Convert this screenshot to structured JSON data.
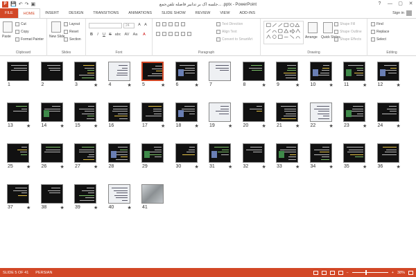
{
  "window": {
    "title": "جلسه اک بر تدابیر فاصله تلفن‌جمع... .pptx - PowerPoint",
    "controls": [
      "?",
      "—",
      "▢",
      "✕"
    ]
  },
  "quick_access": {
    "logo": "P",
    "save": "💾",
    "undo": "↶",
    "redo": "↷",
    "start": "▣"
  },
  "tabs": [
    {
      "label": "FILE",
      "state": "file"
    },
    {
      "label": "HOME",
      "state": "active"
    },
    {
      "label": "INSERT",
      "state": ""
    },
    {
      "label": "DESIGN",
      "state": ""
    },
    {
      "label": "TRANSITIONS",
      "state": ""
    },
    {
      "label": "ANIMATIONS",
      "state": ""
    },
    {
      "label": "SLIDE SHOW",
      "state": ""
    },
    {
      "label": "REVIEW",
      "state": ""
    },
    {
      "label": "VIEW",
      "state": ""
    },
    {
      "label": "ADD-INS",
      "state": ""
    }
  ],
  "signin": "Sign in",
  "ribbon": {
    "clipboard": {
      "label": "Clipboard",
      "paste": "Paste",
      "cut": "Cut",
      "copy": "Copy",
      "format_painter": "Format Painter"
    },
    "slides": {
      "label": "Slides",
      "new_slide": "New Slide",
      "layout": "Layout",
      "reset": "Reset",
      "section": "Section"
    },
    "font": {
      "label": "Font",
      "size": "24",
      "bold": "B",
      "italic": "I",
      "underline": "U",
      "strike": "S",
      "shadow": "abc",
      "spacing": "AV",
      "case": "Aa",
      "color": "A"
    },
    "paragraph": {
      "label": "Paragraph",
      "text_direction": "Text Direction",
      "align_text": "Align Text",
      "convert_smartart": "Convert to SmartArt"
    },
    "drawing": {
      "label": "Drawing",
      "arrange": "Arrange",
      "quick_styles": "Quick Styles",
      "shape_fill": "Shape Fill",
      "shape_outline": "Shape Outline",
      "shape_effects": "Shape Effects"
    },
    "editing": {
      "label": "Editing",
      "find": "Find",
      "replace": "Replace",
      "select": "Select"
    }
  },
  "slides": [
    {
      "n": "1",
      "star": false,
      "kind": "dark"
    },
    {
      "n": "2",
      "star": false,
      "kind": "dark"
    },
    {
      "n": "3",
      "star": true,
      "kind": "dark"
    },
    {
      "n": "4",
      "star": true,
      "kind": "light"
    },
    {
      "n": "5",
      "star": true,
      "kind": "dark"
    },
    {
      "n": "6",
      "star": true,
      "kind": "dark"
    },
    {
      "n": "7",
      "star": false,
      "kind": "light"
    },
    {
      "n": "8",
      "star": true,
      "kind": "dark"
    },
    {
      "n": "9",
      "star": true,
      "kind": "dark"
    },
    {
      "n": "10",
      "star": true,
      "kind": "dark"
    },
    {
      "n": "11",
      "star": true,
      "kind": "dark"
    },
    {
      "n": "12",
      "star": true,
      "kind": "dark"
    },
    {
      "n": "13",
      "star": true,
      "kind": "dark"
    },
    {
      "n": "14",
      "star": true,
      "kind": "dark"
    },
    {
      "n": "15",
      "star": true,
      "kind": "dark"
    },
    {
      "n": "16",
      "star": false,
      "kind": "dark"
    },
    {
      "n": "17",
      "star": true,
      "kind": "dark"
    },
    {
      "n": "18",
      "star": true,
      "kind": "dark"
    },
    {
      "n": "19",
      "star": true,
      "kind": "light"
    },
    {
      "n": "20",
      "star": true,
      "kind": "dark"
    },
    {
      "n": "21",
      "star": true,
      "kind": "dark"
    },
    {
      "n": "22",
      "star": true,
      "kind": "light"
    },
    {
      "n": "23",
      "star": true,
      "kind": "dark"
    },
    {
      "n": "24",
      "star": true,
      "kind": "dark"
    },
    {
      "n": "25",
      "star": true,
      "kind": "dark"
    },
    {
      "n": "26",
      "star": true,
      "kind": "dark"
    },
    {
      "n": "27",
      "star": true,
      "kind": "dark"
    },
    {
      "n": "28",
      "star": false,
      "kind": "dark"
    },
    {
      "n": "29",
      "star": false,
      "kind": "dark"
    },
    {
      "n": "30",
      "star": true,
      "kind": "dark"
    },
    {
      "n": "31",
      "star": true,
      "kind": "dark"
    },
    {
      "n": "32",
      "star": true,
      "kind": "dark"
    },
    {
      "n": "33",
      "star": true,
      "kind": "dark"
    },
    {
      "n": "34",
      "star": true,
      "kind": "dark"
    },
    {
      "n": "35",
      "star": true,
      "kind": "dark"
    },
    {
      "n": "36",
      "star": true,
      "kind": "dark"
    },
    {
      "n": "37",
      "star": true,
      "kind": "dark"
    },
    {
      "n": "38",
      "star": true,
      "kind": "dark"
    },
    {
      "n": "39",
      "star": true,
      "kind": "dark"
    },
    {
      "n": "40",
      "star": true,
      "kind": "light"
    },
    {
      "n": "41",
      "star": false,
      "kind": "photo"
    }
  ],
  "selected_slide": "5",
  "star_glyph": "★",
  "status": {
    "slide_info": "SLIDE 5 OF 41",
    "language": "PERSIAN",
    "zoom": "38%",
    "zoom_level": 0.38
  },
  "colors": {
    "accent": "#d24726"
  }
}
